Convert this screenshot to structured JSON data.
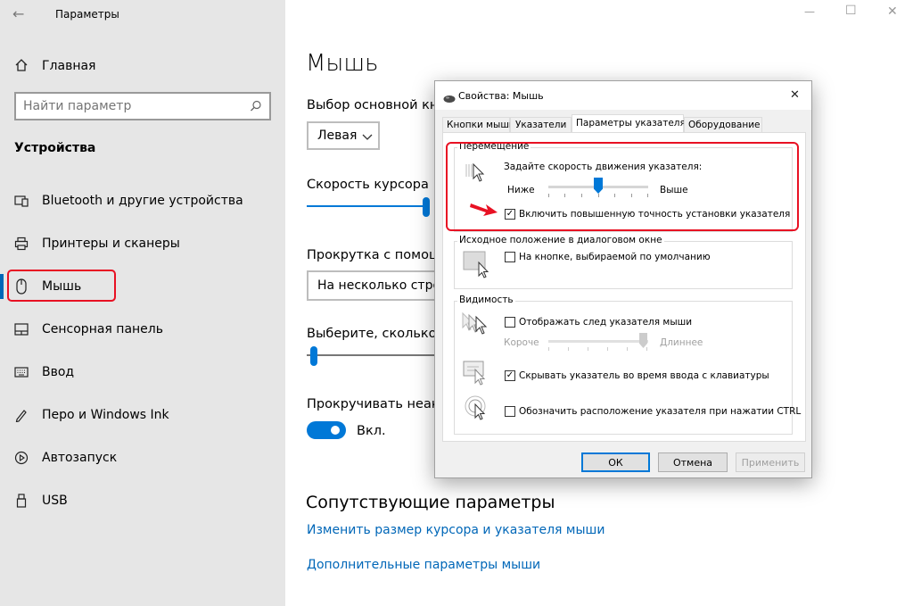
{
  "window": {
    "title": "Параметры",
    "controls": {
      "minimize": "—",
      "maximize": "☐",
      "close": "✕"
    }
  },
  "sidebar": {
    "home_label": "Главная",
    "search_placeholder": "Найти параметр",
    "section_title": "Устройства",
    "items": [
      {
        "label": "Bluetooth и другие устройства",
        "icon": "bluetooth-devices-icon"
      },
      {
        "label": "Принтеры и сканеры",
        "icon": "printer-icon"
      },
      {
        "label": "Мышь",
        "icon": "mouse-icon",
        "selected": true
      },
      {
        "label": "Сенсорная панель",
        "icon": "touchpad-icon"
      },
      {
        "label": "Ввод",
        "icon": "keyboard-icon"
      },
      {
        "label": "Перо и Windows Ink",
        "icon": "pen-icon"
      },
      {
        "label": "Автозапуск",
        "icon": "autoplay-icon"
      },
      {
        "label": "USB",
        "icon": "usb-icon"
      }
    ]
  },
  "main": {
    "page_title": "Мышь",
    "primary_button_label": "Выбор основной кноп",
    "primary_button_value": "Левая",
    "cursor_speed_label": "Скорость курсора",
    "cursor_speed_value": 0.9,
    "scroll_label": "Прокрутка с помощью",
    "scroll_value": "На несколько строк",
    "lines_label": "Выберите, сколько стр",
    "lines_value": 0.05,
    "inactive_scroll_label": "Прокручивать неакти",
    "inactive_scroll_state": "Вкл.",
    "related_title": "Сопутствующие параметры",
    "links": [
      "Изменить размер курсора и указателя мыши",
      "Дополнительные параметры мыши"
    ]
  },
  "dialog": {
    "title": "Свойства: Мышь",
    "close": "✕",
    "tabs": [
      "Кнопки мыши",
      "Указатели",
      "Параметры указателя",
      "Оборудование"
    ],
    "active_tab": 2,
    "motion": {
      "group_title": "Перемещение",
      "speed_label": "Задайте скорость движения указателя:",
      "slow_label": "Ниже",
      "fast_label": "Выше",
      "speed_value": 0.5,
      "precision_label": "Включить повышенную точность установки указателя",
      "precision_checked": true
    },
    "snap": {
      "group_title": "Исходное положение в диалоговом окне",
      "snap_label": "На кнопке, выбираемой по умолчанию",
      "snap_checked": false
    },
    "visibility": {
      "group_title": "Видимость",
      "trails_label": "Отображать след указателя мыши",
      "trails_checked": false,
      "short_label": "Короче",
      "long_label": "Длиннее",
      "hide_label": "Скрывать указатель во время ввода с клавиатуры",
      "hide_checked": true,
      "ctrl_label": "Обозначить расположение указателя при нажатии CTRL",
      "ctrl_checked": false
    },
    "buttons": {
      "ok": "ОК",
      "cancel": "Отмена",
      "apply": "Применить"
    }
  },
  "colors": {
    "accent": "#0067b8",
    "highlight": "#e81123",
    "slider": "#0078d7"
  }
}
